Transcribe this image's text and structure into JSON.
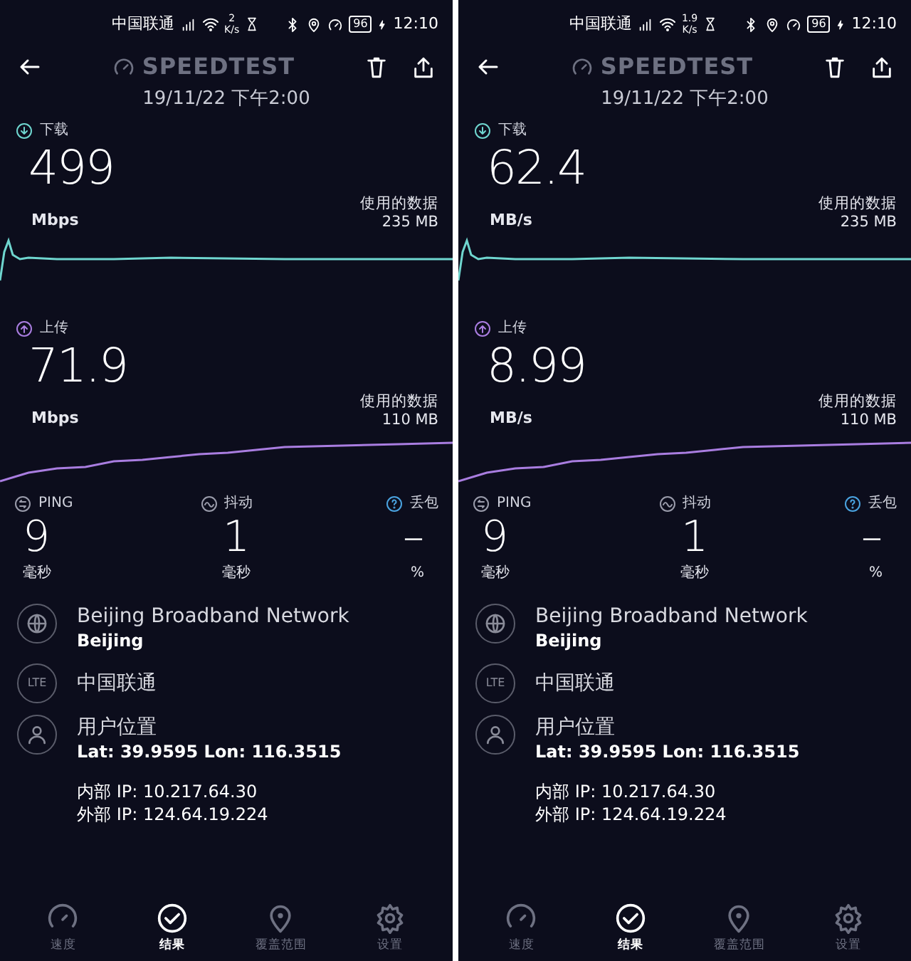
{
  "screens": [
    {
      "status_bar": {
        "carrier": "中国联通",
        "net_speed_value": "2",
        "net_speed_unit": "K/s",
        "battery": "96",
        "time": "12:10"
      },
      "header": {
        "title": "SPEEDTEST",
        "date": "19/11/22 下午2:00"
      },
      "metrics": [
        {
          "kind": "download",
          "label": "下载",
          "value": "499",
          "unit": "Mbps",
          "data_label": "使用的数据",
          "data_value": "235 MB"
        },
        {
          "kind": "upload",
          "label": "上传",
          "value": "71.9",
          "unit": "Mbps",
          "data_label": "使用的数据",
          "data_value": "110 MB"
        }
      ],
      "stats": [
        {
          "kind": "ping",
          "label": "PING",
          "value": "9",
          "unit": "毫秒"
        },
        {
          "kind": "jitter",
          "label": "抖动",
          "value": "1",
          "unit": "毫秒"
        },
        {
          "kind": "loss",
          "label": "丢包",
          "value": "–",
          "unit": "%"
        }
      ],
      "info": [
        {
          "kind": "globe",
          "title": "Beijing Broadband Network",
          "subtitle": "Beijing"
        },
        {
          "kind": "lte",
          "badge": "LTE",
          "title": "中国联通"
        },
        {
          "kind": "person",
          "title": "用户位置",
          "subtitle": "Lat: 39.9595 Lon: 116.3515"
        },
        {
          "kind": "ip",
          "lines": [
            "内部 IP: 10.217.64.30",
            "外部 IP: 124.64.19.224"
          ]
        }
      ],
      "nav": [
        {
          "kind": "speed",
          "label": "速度",
          "selected": false
        },
        {
          "kind": "results",
          "label": "结果",
          "selected": true
        },
        {
          "kind": "coverage",
          "label": "覆盖范围",
          "selected": false
        },
        {
          "kind": "settings",
          "label": "设置",
          "selected": false
        }
      ]
    },
    {
      "status_bar": {
        "carrier": "中国联通",
        "net_speed_value": "1.9",
        "net_speed_unit": "K/s",
        "battery": "96",
        "time": "12:10"
      },
      "header": {
        "title": "SPEEDTEST",
        "date": "19/11/22 下午2:00"
      },
      "metrics": [
        {
          "kind": "download",
          "label": "下载",
          "value": "62.4",
          "unit": "MB/s",
          "data_label": "使用的数据",
          "data_value": "235 MB"
        },
        {
          "kind": "upload",
          "label": "上传",
          "value": "8.99",
          "unit": "MB/s",
          "data_label": "使用的数据",
          "data_value": "110 MB"
        }
      ],
      "stats": [
        {
          "kind": "ping",
          "label": "PING",
          "value": "9",
          "unit": "毫秒"
        },
        {
          "kind": "jitter",
          "label": "抖动",
          "value": "1",
          "unit": "毫秒"
        },
        {
          "kind": "loss",
          "label": "丢包",
          "value": "–",
          "unit": "%"
        }
      ],
      "info": [
        {
          "kind": "globe",
          "title": "Beijing Broadband Network",
          "subtitle": "Beijing"
        },
        {
          "kind": "lte",
          "badge": "LTE",
          "title": "中国联通"
        },
        {
          "kind": "person",
          "title": "用户位置",
          "subtitle": "Lat: 39.9595 Lon: 116.3515"
        },
        {
          "kind": "ip",
          "lines": [
            "内部 IP: 10.217.64.30",
            "外部 IP: 124.64.19.224"
          ]
        }
      ],
      "nav": [
        {
          "kind": "speed",
          "label": "速度",
          "selected": false
        },
        {
          "kind": "results",
          "label": "结果",
          "selected": true
        },
        {
          "kind": "coverage",
          "label": "覆盖范围",
          "selected": false
        },
        {
          "kind": "settings",
          "label": "设置",
          "selected": false
        }
      ]
    }
  ]
}
